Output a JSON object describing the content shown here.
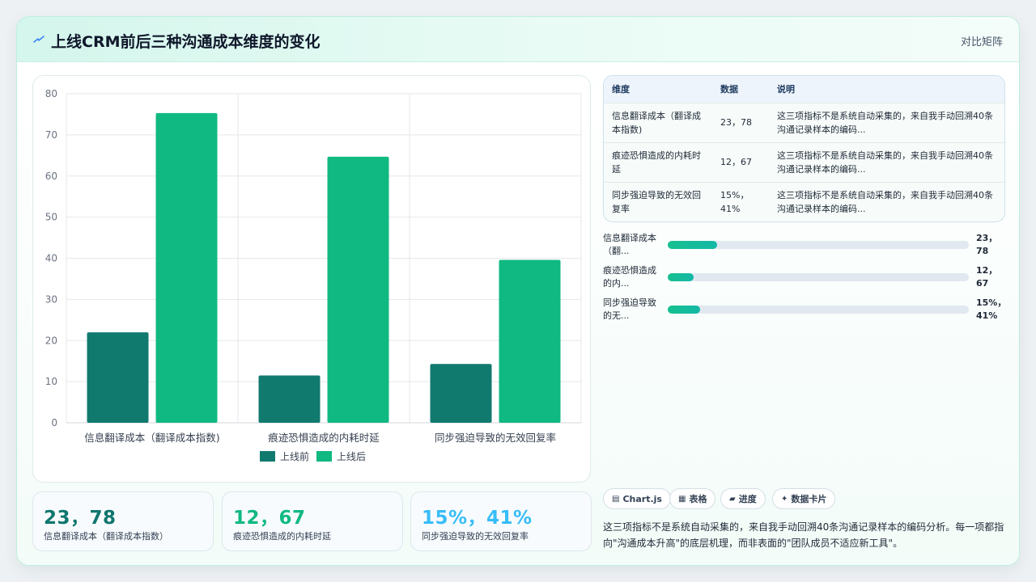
{
  "header": {
    "icon": "lightning-icon",
    "title": "上线CRM前后三种沟通成本维度的变化",
    "right_label": "对比矩阵"
  },
  "colors": {
    "before": "#117a6f",
    "after": "#10b981",
    "kpi1": "#0f766e",
    "kpi2": "#10b981",
    "kpi3": "#38bdf8"
  },
  "chart_data": {
    "type": "bar",
    "categories": [
      "信息翻译成本（翻译成本指数)",
      "痕迹恐惧造成的内耗时延",
      "同步强迫导致的无效回复率"
    ],
    "series": [
      {
        "name": "上线前",
        "values": [
          22,
          11.5,
          14.3
        ],
        "color": "#117a6f"
      },
      {
        "name": "上线后",
        "values": [
          75.3,
          64.7,
          39.6
        ],
        "color": "#10b981"
      }
    ],
    "ylim": [
      0,
      80
    ],
    "yticks": [
      0,
      10,
      20,
      30,
      40,
      50,
      60,
      70,
      80
    ],
    "grid": true,
    "legend": "bottom"
  },
  "kpis": [
    {
      "value": "23，78",
      "label": "信息翻译成本（翻译成本指数）"
    },
    {
      "value": "12，67",
      "label": "痕迹恐惧造成的内耗时延"
    },
    {
      "value": "15%，41%",
      "label": "同步强迫导致的无效回复率"
    }
  ],
  "table": {
    "headers": [
      "维度",
      "数据",
      "说明"
    ],
    "rows": [
      {
        "dim": "信息翻译成本（翻译成本指数)",
        "data": "23，78",
        "desc": "这三项指标不是系统自动采集的，来自我手动回溯40条沟通记录样本的编码..."
      },
      {
        "dim": "痕迹恐惧造成的内耗时延",
        "data": "12，67",
        "desc": "这三项指标不是系统自动采集的，来自我手动回溯40条沟通记录样本的编码..."
      },
      {
        "dim": "同步强迫导致的无效回复率",
        "data": "15%，41%",
        "desc": "这三项指标不是系统自动采集的，来自我手动回溯40条沟通记录样本的编码..."
      }
    ]
  },
  "progress": [
    {
      "label": "信息翻译成本（翻...",
      "value": "23，78",
      "fraction": 0.165
    },
    {
      "label": "痕迹恐惧造成的内...",
      "value": "12，67",
      "fraction": 0.085
    },
    {
      "label": "同步强迫导致的无...",
      "value": "15%，41%",
      "fraction": 0.107
    }
  ],
  "chips": [
    {
      "icon": "chart-icon",
      "glyph": "▤",
      "label": "Chart.js"
    },
    {
      "icon": "table-icon",
      "glyph": "▦",
      "label": "表格"
    },
    {
      "icon": "progress-icon",
      "glyph": "▰",
      "label": "进度"
    },
    {
      "icon": "sparkle-icon",
      "glyph": "✦",
      "label": "数据卡片"
    }
  ],
  "note": "这三项指标不是系统自动采集的，来自我手动回溯40条沟通记录样本的编码分析。每一项都指向\"沟通成本升高\"的底层机理，而非表面的\"团队成员不适应新工具\"。"
}
